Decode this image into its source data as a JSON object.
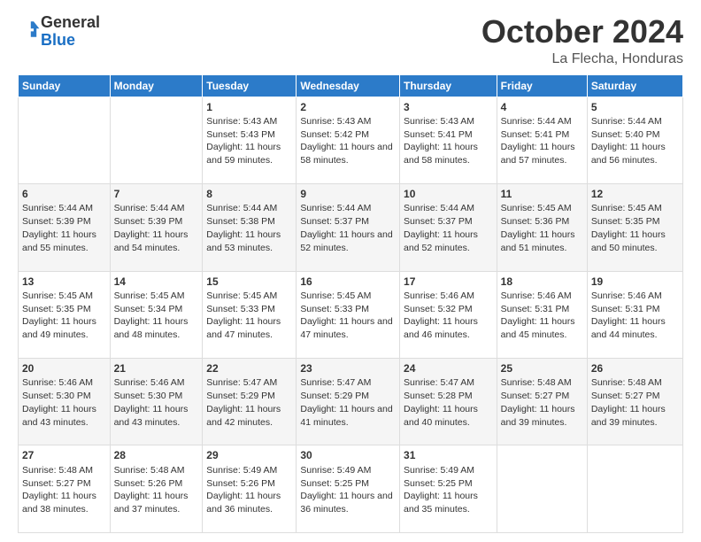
{
  "logo": {
    "line1": "General",
    "line2": "Blue"
  },
  "header": {
    "month": "October 2024",
    "location": "La Flecha, Honduras"
  },
  "weekdays": [
    "Sunday",
    "Monday",
    "Tuesday",
    "Wednesday",
    "Thursday",
    "Friday",
    "Saturday"
  ],
  "weeks": [
    [
      null,
      null,
      {
        "day": "1",
        "sunrise": "5:43 AM",
        "sunset": "5:43 PM",
        "daylight": "11 hours and 59 minutes."
      },
      {
        "day": "2",
        "sunrise": "5:43 AM",
        "sunset": "5:42 PM",
        "daylight": "11 hours and 58 minutes."
      },
      {
        "day": "3",
        "sunrise": "5:43 AM",
        "sunset": "5:41 PM",
        "daylight": "11 hours and 58 minutes."
      },
      {
        "day": "4",
        "sunrise": "5:44 AM",
        "sunset": "5:41 PM",
        "daylight": "11 hours and 57 minutes."
      },
      {
        "day": "5",
        "sunrise": "5:44 AM",
        "sunset": "5:40 PM",
        "daylight": "11 hours and 56 minutes."
      }
    ],
    [
      {
        "day": "6",
        "sunrise": "5:44 AM",
        "sunset": "5:39 PM",
        "daylight": "11 hours and 55 minutes."
      },
      {
        "day": "7",
        "sunrise": "5:44 AM",
        "sunset": "5:39 PM",
        "daylight": "11 hours and 54 minutes."
      },
      {
        "day": "8",
        "sunrise": "5:44 AM",
        "sunset": "5:38 PM",
        "daylight": "11 hours and 53 minutes."
      },
      {
        "day": "9",
        "sunrise": "5:44 AM",
        "sunset": "5:37 PM",
        "daylight": "11 hours and 52 minutes."
      },
      {
        "day": "10",
        "sunrise": "5:44 AM",
        "sunset": "5:37 PM",
        "daylight": "11 hours and 52 minutes."
      },
      {
        "day": "11",
        "sunrise": "5:45 AM",
        "sunset": "5:36 PM",
        "daylight": "11 hours and 51 minutes."
      },
      {
        "day": "12",
        "sunrise": "5:45 AM",
        "sunset": "5:35 PM",
        "daylight": "11 hours and 50 minutes."
      }
    ],
    [
      {
        "day": "13",
        "sunrise": "5:45 AM",
        "sunset": "5:35 PM",
        "daylight": "11 hours and 49 minutes."
      },
      {
        "day": "14",
        "sunrise": "5:45 AM",
        "sunset": "5:34 PM",
        "daylight": "11 hours and 48 minutes."
      },
      {
        "day": "15",
        "sunrise": "5:45 AM",
        "sunset": "5:33 PM",
        "daylight": "11 hours and 47 minutes."
      },
      {
        "day": "16",
        "sunrise": "5:45 AM",
        "sunset": "5:33 PM",
        "daylight": "11 hours and 47 minutes."
      },
      {
        "day": "17",
        "sunrise": "5:46 AM",
        "sunset": "5:32 PM",
        "daylight": "11 hours and 46 minutes."
      },
      {
        "day": "18",
        "sunrise": "5:46 AM",
        "sunset": "5:31 PM",
        "daylight": "11 hours and 45 minutes."
      },
      {
        "day": "19",
        "sunrise": "5:46 AM",
        "sunset": "5:31 PM",
        "daylight": "11 hours and 44 minutes."
      }
    ],
    [
      {
        "day": "20",
        "sunrise": "5:46 AM",
        "sunset": "5:30 PM",
        "daylight": "11 hours and 43 minutes."
      },
      {
        "day": "21",
        "sunrise": "5:46 AM",
        "sunset": "5:30 PM",
        "daylight": "11 hours and 43 minutes."
      },
      {
        "day": "22",
        "sunrise": "5:47 AM",
        "sunset": "5:29 PM",
        "daylight": "11 hours and 42 minutes."
      },
      {
        "day": "23",
        "sunrise": "5:47 AM",
        "sunset": "5:29 PM",
        "daylight": "11 hours and 41 minutes."
      },
      {
        "day": "24",
        "sunrise": "5:47 AM",
        "sunset": "5:28 PM",
        "daylight": "11 hours and 40 minutes."
      },
      {
        "day": "25",
        "sunrise": "5:48 AM",
        "sunset": "5:27 PM",
        "daylight": "11 hours and 39 minutes."
      },
      {
        "day": "26",
        "sunrise": "5:48 AM",
        "sunset": "5:27 PM",
        "daylight": "11 hours and 39 minutes."
      }
    ],
    [
      {
        "day": "27",
        "sunrise": "5:48 AM",
        "sunset": "5:27 PM",
        "daylight": "11 hours and 38 minutes."
      },
      {
        "day": "28",
        "sunrise": "5:48 AM",
        "sunset": "5:26 PM",
        "daylight": "11 hours and 37 minutes."
      },
      {
        "day": "29",
        "sunrise": "5:49 AM",
        "sunset": "5:26 PM",
        "daylight": "11 hours and 36 minutes."
      },
      {
        "day": "30",
        "sunrise": "5:49 AM",
        "sunset": "5:25 PM",
        "daylight": "11 hours and 36 minutes."
      },
      {
        "day": "31",
        "sunrise": "5:49 AM",
        "sunset": "5:25 PM",
        "daylight": "11 hours and 35 minutes."
      },
      null,
      null
    ]
  ],
  "labels": {
    "sunrise": "Sunrise:",
    "sunset": "Sunset:",
    "daylight": "Daylight:"
  }
}
